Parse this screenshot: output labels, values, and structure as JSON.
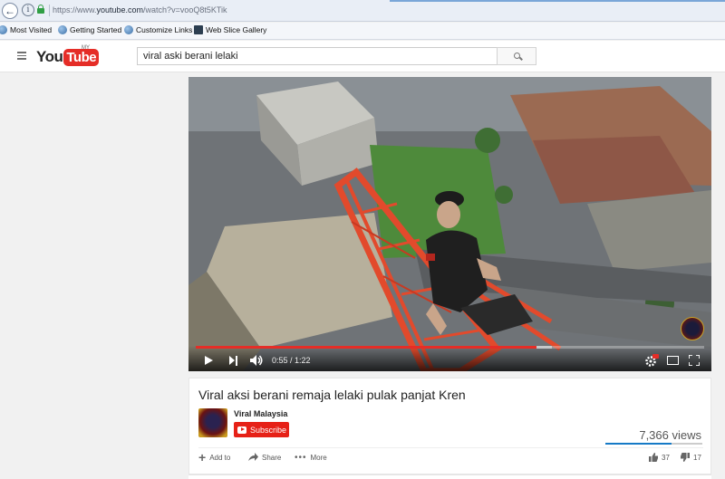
{
  "browser": {
    "url_prefix": "https://www.",
    "url_domain": "youtube.com",
    "url_path": "/watch?v=vooQ8t5KTik",
    "bookmarks": [
      {
        "label": "Most Visited",
        "icon": "globe-icon"
      },
      {
        "label": "Getting Started",
        "icon": "globe-icon"
      },
      {
        "label": "Customize Links",
        "icon": "globe-icon"
      },
      {
        "label": "Web Slice Gallery",
        "icon": "web-slice-icon"
      }
    ]
  },
  "header": {
    "logo_you": "You",
    "logo_tube": "Tube",
    "country": "MY",
    "search_value": "viral aski berani lelaki",
    "search_icon": "search-icon"
  },
  "player": {
    "time": "0:55 / 1:22",
    "progress_fraction": 0.67,
    "buffer_fraction": 0.7
  },
  "video": {
    "title": "Viral aksi berani remaja lelaki pulak panjat Kren",
    "channel": "Viral Malaysia",
    "subscribe_label": "Subscribe",
    "views": "7,366 views",
    "like_fraction": 0.685,
    "add_to_label": "Add to",
    "share_label": "Share",
    "more_label": "More",
    "likes": "37",
    "dislikes": "17"
  },
  "colors": {
    "brand_red": "#e52d27",
    "like_blue": "#167ac6"
  }
}
